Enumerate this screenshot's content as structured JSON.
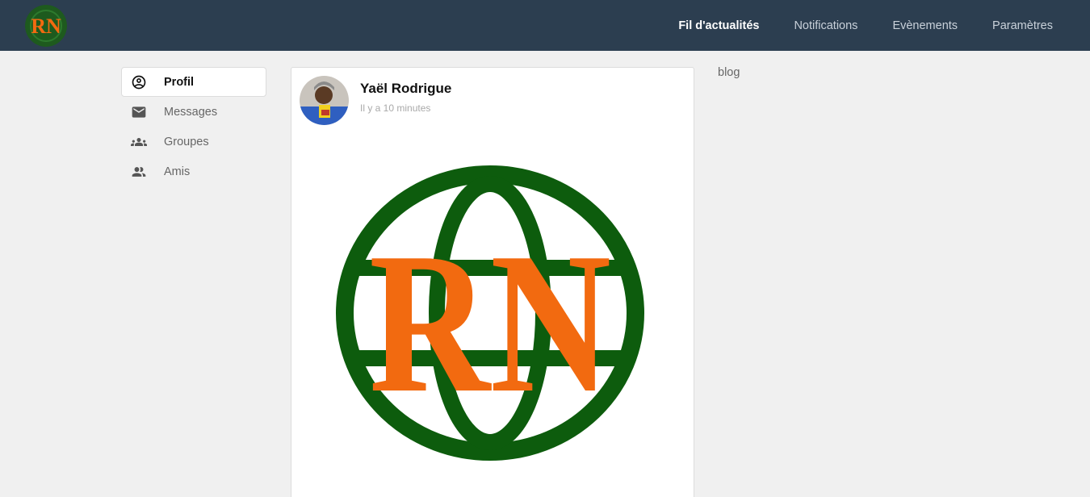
{
  "header": {
    "logo_text": "RN",
    "nav": [
      {
        "label": "Fil d'actualités",
        "active": true
      },
      {
        "label": "Notifications",
        "active": false
      },
      {
        "label": "Evènements",
        "active": false
      },
      {
        "label": "Paramètres",
        "active": false
      }
    ]
  },
  "sidebar": {
    "items": [
      {
        "label": "Profil",
        "icon": "account-circle-icon",
        "active": true
      },
      {
        "label": "Messages",
        "icon": "mail-icon",
        "active": false
      },
      {
        "label": "Groupes",
        "icon": "groups-icon",
        "active": false
      },
      {
        "label": "Amis",
        "icon": "people-icon",
        "active": false
      }
    ]
  },
  "post": {
    "author": "Yaël Rodrigue",
    "time": "Il y a 10 minutes",
    "image_text": "RN"
  },
  "right_panel": {
    "title": "blog"
  },
  "colors": {
    "header_bg": "#2c3e50",
    "logo_green": "#0d5c0d",
    "logo_orange": "#f26a10",
    "page_bg": "#f0f0f0"
  }
}
